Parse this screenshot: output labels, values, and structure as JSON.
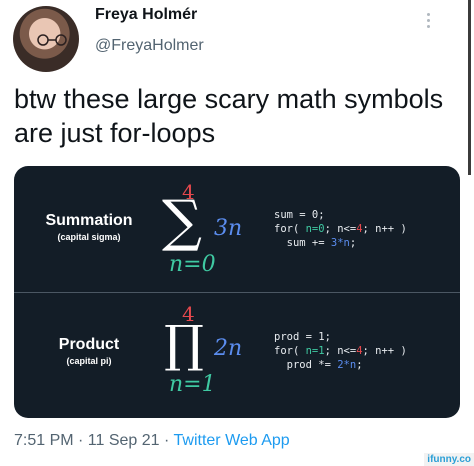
{
  "header": {
    "name": "Freya Holmér",
    "handle": "@FreyaHolmer"
  },
  "tweet": {
    "text": "btw these large scary math symbols are just for-loops"
  },
  "card": {
    "summation": {
      "title": "Summation",
      "subtitle": "(capital sigma)",
      "symbol": "∑",
      "upper": "4",
      "lower": "n=0",
      "body": "3n",
      "code": {
        "line1": "sum = 0;",
        "line2_a": "for( ",
        "line2_b": "n=0",
        "line2_c": "; n<=",
        "line2_d": "4",
        "line2_e": "; n++ )",
        "line3_a": "  sum += ",
        "line3_b": "3*n",
        "line3_c": ";"
      }
    },
    "product": {
      "title": "Product",
      "subtitle": "(capital pi)",
      "symbol": "∏",
      "upper": "4",
      "lower": "n=1",
      "body": "2n",
      "code": {
        "line1": "prod = 1;",
        "line2_a": "for( ",
        "line2_b": "n=1",
        "line2_c": "; n<=",
        "line2_d": "4",
        "line2_e": "; n++ )",
        "line3_a": "  prod *= ",
        "line3_b": "2*n",
        "line3_c": ";"
      }
    }
  },
  "meta": {
    "time_date": "7:51 PM · 11 Sep 21 · ",
    "app": "Twitter Web App"
  },
  "watermark": "ifunny.co",
  "colors": {
    "card_bg": "#131d27",
    "upper_limit": "#e5484d",
    "lower_limit": "#3fc9a2",
    "body_term": "#5b8def",
    "link": "#1d9bf0"
  },
  "icons": [
    "avatar",
    "more-options-icon"
  ]
}
